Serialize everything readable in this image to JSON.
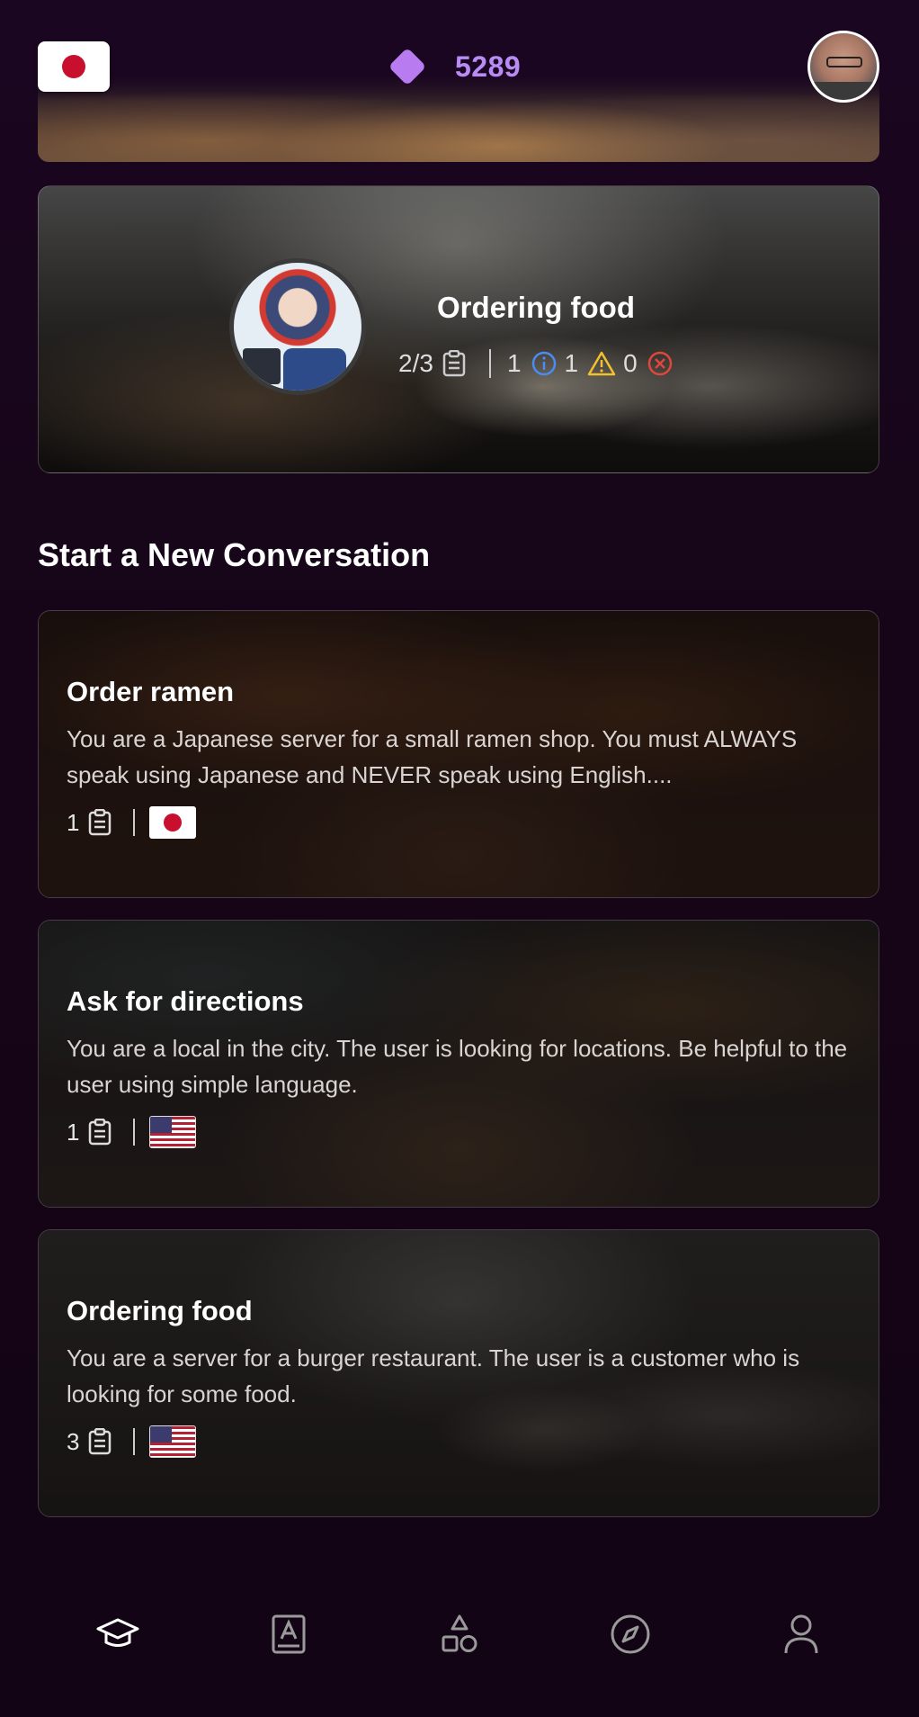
{
  "header": {
    "flag": "japan-flag",
    "gems": "5289",
    "avatar": "user-avatar"
  },
  "current": {
    "title": "Ordering food",
    "progress": "2/3",
    "info_count": "1",
    "warning_count": "1",
    "error_count": "0"
  },
  "section_title": "Start a New Conversation",
  "conversations": [
    {
      "title": "Order ramen",
      "description": "You are a Japanese server for a small ramen shop. You must ALWAYS speak using Japanese and NEVER speak using English....",
      "count": "1",
      "flag": "japan-flag"
    },
    {
      "title": "Ask for directions",
      "description": "You are a local in the city. The user is looking for locations. Be helpful to the user using simple language.",
      "count": "1",
      "flag": "us-flag"
    },
    {
      "title": "Ordering food",
      "description": "You are a server for a burger restaurant. The user is a customer who is looking for some food.",
      "count": "3",
      "flag": "us-flag"
    }
  ],
  "nav": [
    "learn-icon",
    "dictionary-icon",
    "shapes-icon",
    "explore-icon",
    "profile-icon"
  ],
  "colors": {
    "accent": "#b98cf5",
    "info": "#4a8cf0",
    "warning": "#f2c12e",
    "error": "#e0473c"
  }
}
